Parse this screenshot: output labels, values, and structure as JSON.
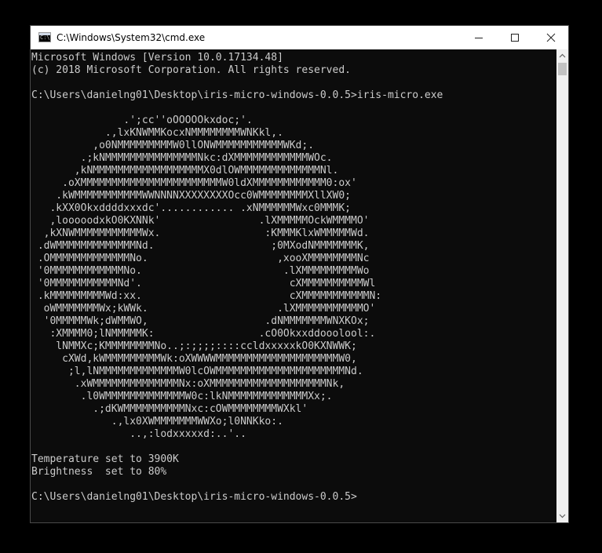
{
  "window": {
    "title": "C:\\Windows\\System32\\cmd.exe",
    "icon": "cmd-icon",
    "icon_text": "C:\\",
    "controls": [
      "minimize-icon",
      "maximize-icon",
      "close-icon"
    ]
  },
  "console": {
    "lines": [
      "Microsoft Windows [Version 10.0.17134.48]",
      "(c) 2018 Microsoft Corporation. All rights reserved.",
      "",
      "C:\\Users\\danielng01\\Desktop\\iris-micro-windows-0.0.5>iris-micro.exe",
      "",
      "               .';cc''oOOOOOkxdoc;'.",
      "            .,lxKNWMMKocxNMMMMMMMMWNKkl,.",
      "          ,o0NMMMMMMMMMW0llONWMMMMMMMMMMMWKd;.",
      "        .;kNMMMMMMMMMMMMMMMNkc:dXMMMMMMMMMMMMWOc.",
      "       ,kNMMMMMMMMMMMMMMMMMMX0dlOWMMMMMMMMMMMMMNl.",
      "     .oXMMMMMMMMMMMMMMMMMMMMMMMW0ldXMMMMMMMMMMMM0:ox'",
      "    .kWMMMMMMMMMMMWWNNNNXXXXXXXXOcc0WMMMMMMMMXllXW0;",
      "   .kXX0Okxddddxxxdc'............ .xNMMMMMMWxc0MMMK;",
      "   ,looooodxkO0KXNNk'                .lXMMMMMOckWMMMMO'",
      "  ,kXNWMMMMMMMMMMMWx.                 :KMMMKlxWMMMMMWd.",
      " .dWMMMMMMMMMMMMMNd.                   ;0MXodNMMMMMMMK,",
      " .OMMMMMMMMMMMMMNo.                     ,xooXMMMMMMMMNc",
      " '0MMMMMMMMMMMMNo.                       .lXMMMMMMMMMWo",
      " '0MMMMMMMMMMMNd'.                        cXMMMMMMMMMMWl",
      " .kMMMMMMMMMWd:xx.                        cXMMMMMMMMMMMN:",
      "  oWMMMMMMMWx;kWWk.                     .lXMMMMMMMMMMMO'",
      "  '0MMMMMWk;dWMMWO,                   .dNMMMMMMMWNXKOx;",
      "   :XMMMM0;lNMMMMMK:                 .cO0Okxxddooolool:.",
      "    lNMMXc;KMMMMMMMMNo..;:;;;;::::ccldxxxxxkO0KXNWWK;",
      "     cXWd,kWMMMMMMMMMWk:oXWWWWMMMMMMMMMMMMMMMMMMMMW0,",
      "      ;l,lNMMMMMMMMMMMMMW0lcOWMMMMMMMMMMMMMMMMMMMMMNd.",
      "       .xWMMMMMMMMMMMMMMNx:oXMMMMMMMMMMMMMMMMMMMNk,",
      "        .l0WMMMMMMMMMMMMMW0c:lkNMMMMMMMMMMMMMXx;.",
      "          .;dKWMMMMMMMMMMNxc:cOWMMMMMMMMWXkl'",
      "             .,lx0XWMMMMMMMWWXo;l0NNKko:.",
      "                ..,:lodxxxxxd:..'..",
      "",
      "Temperature set to 3900K",
      "Brightness  set to 80%",
      "",
      "C:\\Users\\danielng01\\Desktop\\iris-micro-windows-0.0.5>"
    ]
  },
  "scrollbar": {
    "up_icon": "scroll-up-arrow-icon",
    "down_icon": "scroll-down-arrow-icon"
  },
  "colors": {
    "console_bg": "#0c0c0c",
    "console_text": "#cccccc",
    "titlebar_bg": "#ffffff"
  }
}
